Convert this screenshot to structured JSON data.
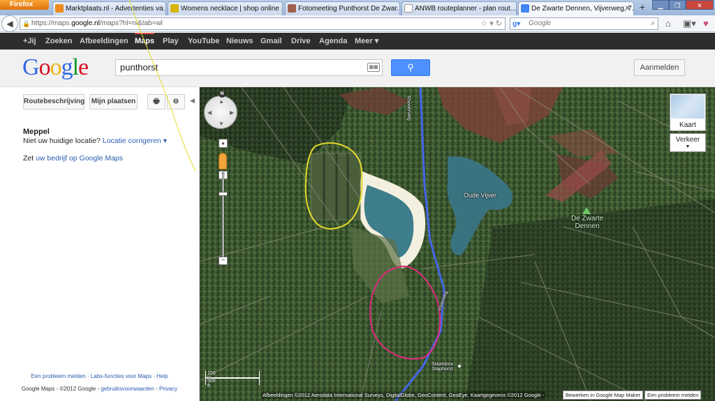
{
  "browser": {
    "firefox_label": "Firefox",
    "tabs": [
      {
        "title": "Marktplaats.nl - Advertenties va...",
        "fav_color": "#f08a1e"
      },
      {
        "title": "Womens necklace | shop online ...",
        "fav_color": "#d8b400"
      },
      {
        "title": "Fotomeeting Punthorst De Zwar...",
        "fav_color": "#a06050"
      },
      {
        "title": "ANWB routeplanner - plan rout...",
        "fav_color": "#ffffff"
      },
      {
        "title": "De Zwarte Dennen, Vijverweg, 7...",
        "fav_color": "#4285f4"
      }
    ],
    "url_prefix": "https://maps.",
    "url_domain": "google.nl",
    "url_suffix": "/maps?hl=nl&tab=wl",
    "search_engine": "Google",
    "search_placeholder": "Google"
  },
  "gbar": {
    "items": [
      "+Jij",
      "Zoeken",
      "Afbeeldingen",
      "Maps",
      "Play",
      "YouTube",
      "Nieuws",
      "Gmail",
      "Drive",
      "Agenda",
      "Meer ▾"
    ]
  },
  "header": {
    "logo": "Google",
    "query": "punthorst",
    "signin": "Aanmelden"
  },
  "left": {
    "route_button": "Routebeschrijving",
    "places_button": "Mijn plaatsen",
    "location_title": "Meppel",
    "location_question": "Niet uw huidige locatie?",
    "location_fix": "Locatie corrigeren ▾",
    "business_prefix": "Zet",
    "business_link": "uw bedrijf op Google Maps",
    "footer_links": [
      "Een probleem melden",
      "Labs-functies voor Maps",
      "Help"
    ],
    "footer_copyright": "Google Maps - ©2012 Google -",
    "footer_terms": "gebruiksvoorwaarden",
    "footer_privacy": "Privacy"
  },
  "map": {
    "maptype_label": "Kaart",
    "traffic_label": "Verkeer",
    "label_oude_vijver": "Oude Vijver",
    "label_zwarte_dennen_1": "De Zwarte",
    "label_zwarte_dennen_2": "Dennen",
    "label_staatsbos_1": "Staatsbos",
    "label_staatsbos_2": "Staphorst",
    "road_label_1": "Rheeërweg",
    "road_label_2": "Vijverweg",
    "scale_m": "100 m",
    "scale_ft": "500 ft",
    "attribution": "Afbeeldingen ©2012 Aerodata International Surveys, DigitalGlobe, GeoContent, GeoEye, Kaartgegevens ©2012 Google -",
    "edit_button": "Bewerken in Google Map Maker",
    "report_button": "Een probleem melden",
    "compass_n": "N"
  }
}
